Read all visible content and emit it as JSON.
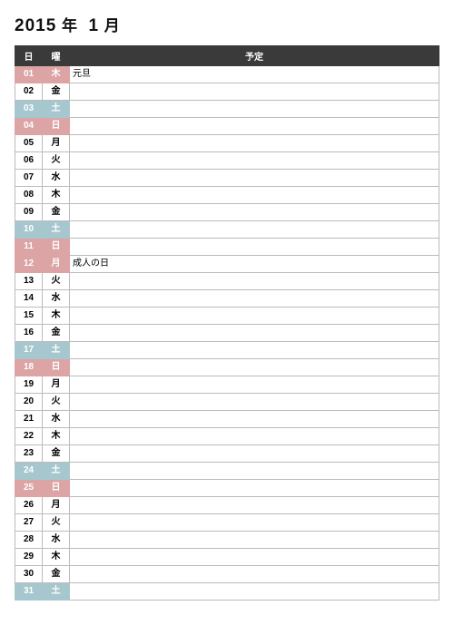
{
  "title": {
    "year": "2015",
    "year_suffix": "年",
    "month": "1",
    "month_suffix": "月"
  },
  "headers": {
    "day": "日",
    "dow": "曜",
    "schedule": "予定"
  },
  "rows": [
    {
      "day": "01",
      "dow": "木",
      "type": "hol",
      "schedule": "元旦"
    },
    {
      "day": "02",
      "dow": "金",
      "type": "",
      "schedule": ""
    },
    {
      "day": "03",
      "dow": "土",
      "type": "sat",
      "schedule": ""
    },
    {
      "day": "04",
      "dow": "日",
      "type": "sun",
      "schedule": ""
    },
    {
      "day": "05",
      "dow": "月",
      "type": "",
      "schedule": ""
    },
    {
      "day": "06",
      "dow": "火",
      "type": "",
      "schedule": ""
    },
    {
      "day": "07",
      "dow": "水",
      "type": "",
      "schedule": ""
    },
    {
      "day": "08",
      "dow": "木",
      "type": "",
      "schedule": ""
    },
    {
      "day": "09",
      "dow": "金",
      "type": "",
      "schedule": ""
    },
    {
      "day": "10",
      "dow": "土",
      "type": "sat",
      "schedule": ""
    },
    {
      "day": "11",
      "dow": "日",
      "type": "sun",
      "schedule": ""
    },
    {
      "day": "12",
      "dow": "月",
      "type": "hol",
      "schedule": "成人の日"
    },
    {
      "day": "13",
      "dow": "火",
      "type": "",
      "schedule": ""
    },
    {
      "day": "14",
      "dow": "水",
      "type": "",
      "schedule": ""
    },
    {
      "day": "15",
      "dow": "木",
      "type": "",
      "schedule": ""
    },
    {
      "day": "16",
      "dow": "金",
      "type": "",
      "schedule": ""
    },
    {
      "day": "17",
      "dow": "土",
      "type": "sat",
      "schedule": ""
    },
    {
      "day": "18",
      "dow": "日",
      "type": "sun",
      "schedule": ""
    },
    {
      "day": "19",
      "dow": "月",
      "type": "",
      "schedule": ""
    },
    {
      "day": "20",
      "dow": "火",
      "type": "",
      "schedule": ""
    },
    {
      "day": "21",
      "dow": "水",
      "type": "",
      "schedule": ""
    },
    {
      "day": "22",
      "dow": "木",
      "type": "",
      "schedule": ""
    },
    {
      "day": "23",
      "dow": "金",
      "type": "",
      "schedule": ""
    },
    {
      "day": "24",
      "dow": "土",
      "type": "sat",
      "schedule": ""
    },
    {
      "day": "25",
      "dow": "日",
      "type": "sun",
      "schedule": ""
    },
    {
      "day": "26",
      "dow": "月",
      "type": "",
      "schedule": ""
    },
    {
      "day": "27",
      "dow": "火",
      "type": "",
      "schedule": ""
    },
    {
      "day": "28",
      "dow": "水",
      "type": "",
      "schedule": ""
    },
    {
      "day": "29",
      "dow": "木",
      "type": "",
      "schedule": ""
    },
    {
      "day": "30",
      "dow": "金",
      "type": "",
      "schedule": ""
    },
    {
      "day": "31",
      "dow": "土",
      "type": "sat",
      "schedule": ""
    }
  ]
}
